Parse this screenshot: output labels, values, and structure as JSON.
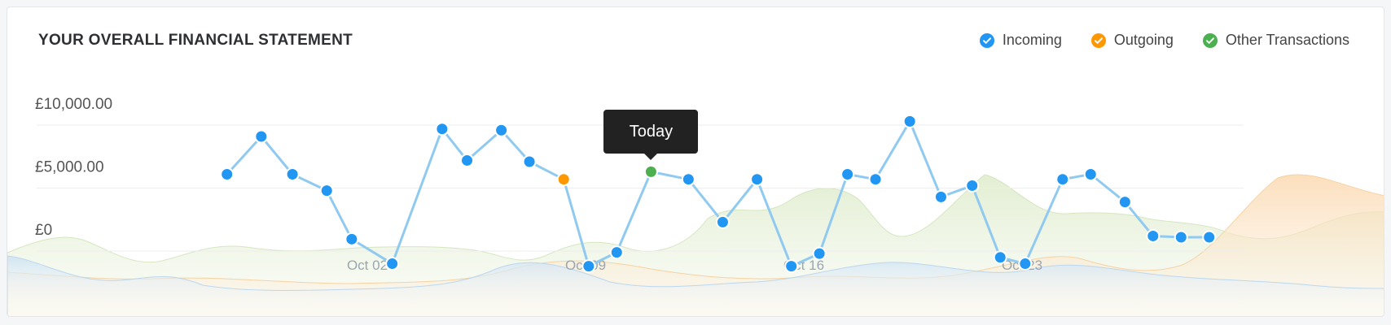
{
  "header": {
    "title": "YOUR OVERALL FINANCIAL STATEMENT"
  },
  "legend": [
    {
      "label": "Incoming",
      "color": "#2196f3",
      "icon": "check-icon"
    },
    {
      "label": "Outgoing",
      "color": "#ff9800",
      "icon": "check-icon"
    },
    {
      "label": "Other Transactions",
      "color": "#4caf50",
      "icon": "check-icon"
    }
  ],
  "tooltip": {
    "label": "Today"
  },
  "chart_data": {
    "type": "line",
    "title": "YOUR OVERALL FINANCIAL STATEMENT",
    "xlabel": "",
    "ylabel": "",
    "y_ticks": [
      "£10,000.00",
      "£5,000.00",
      "£0"
    ],
    "y_tick_values": [
      10000,
      5000,
      0
    ],
    "x_ticks": [
      "Oct 02",
      "Oct 09",
      "Oct 16",
      "Oct 23"
    ],
    "x_tick_values": [
      0,
      7,
      14,
      21
    ],
    "ylim": [
      0,
      10000
    ],
    "grid": true,
    "legend_position": "top-right",
    "series": [
      {
        "name": "Incoming",
        "color": "#2196f3",
        "x": [
          -4.5,
          -3.4,
          -2.4,
          -1.3,
          -0.5,
          0.8,
          2.4,
          3.2,
          4.3,
          5.2,
          6.3,
          7.1,
          8.0,
          9.1,
          10.3,
          11.4,
          12.5,
          13.6,
          14.5,
          15.4,
          16.3,
          17.4,
          18.4,
          19.4,
          20.3,
          21.1,
          22.3,
          23.2,
          24.3,
          25.2,
          26.1,
          27.0
        ],
        "y": [
          5000,
          8000,
          5000,
          3700,
          -150,
          -2100,
          8600,
          6100,
          8500,
          6000,
          4600,
          -2300,
          -1200,
          5200,
          4600,
          1200,
          4600,
          -2300,
          -1300,
          5000,
          4600,
          9200,
          3200,
          4100,
          -1600,
          -2100,
          4600,
          5000,
          2800,
          100,
          0,
          0
        ],
        "highlight": [
          {
            "index": 10,
            "color": "#ff9800"
          },
          {
            "index": 13,
            "color": "#4caf50"
          }
        ]
      }
    ]
  }
}
